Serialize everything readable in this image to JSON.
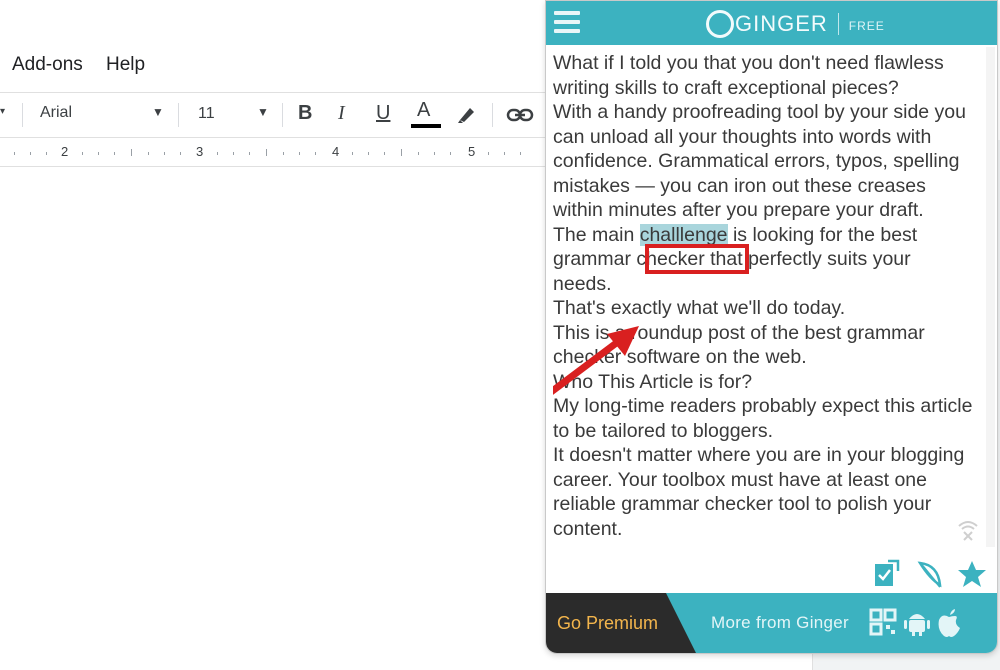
{
  "docs": {
    "menu": [
      "Add-ons",
      "Help"
    ],
    "toolbar": {
      "font": "Arial",
      "font_size": "11",
      "bold": "B",
      "italic": "I",
      "underline": "U",
      "text_color": "A"
    },
    "ruler_numbers": [
      "2",
      "3",
      "4",
      "5"
    ]
  },
  "ginger": {
    "brand": "GINGER",
    "plan": "FREE",
    "colors": {
      "accent": "#3cb2c0",
      "premium_bg": "#2b2b2b",
      "premium_text": "#f3b54c",
      "highlight": "#a9d5dc",
      "callout": "#d92020"
    },
    "paragraphs": [
      "What if I told you that you don't need flawless writing skills to craft exceptional pieces?",
      "With a handy proofreading tool by your side you can unload all your thoughts into words with confidence. Grammatical errors, typos, spelling mistakes — you can iron out these creases within minutes after you prepare your draft.",
      "That's exactly what we'll do today.",
      "This is a roundup post of the best grammar checker software on the web.",
      "Who This Article is for?",
      "My long-time readers probably expect this article to be tailored to bloggers.",
      "It doesn't matter where you are in your blogging career. Your toolbox must have at least one reliable grammar checker tool to polish your content."
    ],
    "flagged_sentence": {
      "before": "The main ",
      "flagged_word": "challlenge",
      "after": " is looking for the best grammar checker that perfectly suits your needs."
    },
    "footer": {
      "go_premium": "Go Premium",
      "more_from": "More from Ginger"
    },
    "icons": [
      "menu-icon",
      "no-connection-icon",
      "rephrase-icon",
      "quill-icon",
      "star-icon",
      "qr-code-icon",
      "android-icon",
      "apple-icon"
    ]
  }
}
